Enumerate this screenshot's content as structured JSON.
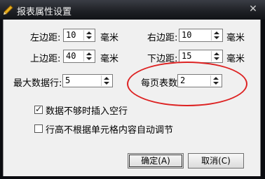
{
  "window": {
    "title": "报表属性设置",
    "close_glyph": "✕"
  },
  "fields": {
    "left_margin": {
      "label": "左边距:",
      "value": "10",
      "unit": "毫米"
    },
    "right_margin": {
      "label": "右边距:",
      "value": "10",
      "unit": "毫米"
    },
    "top_margin": {
      "label": "上边距:",
      "value": "40",
      "unit": "毫米"
    },
    "bottom_margin": {
      "label": "下边距:",
      "value": "15",
      "unit": "毫米"
    },
    "max_rows": {
      "label": "最大数据行:",
      "value": "5"
    },
    "rows_per_page": {
      "label": "每页表数:",
      "value": "2"
    }
  },
  "options": {
    "insert_blank": {
      "label": "数据不够时插入空行",
      "checked": true
    },
    "auto_height": {
      "label": "行高不根据单元格内容自动调节",
      "checked": false
    }
  },
  "buttons": {
    "ok": "确定(A)",
    "cancel": "取消(C)"
  },
  "colors": {
    "highlight_ellipse": "#dd2222"
  }
}
